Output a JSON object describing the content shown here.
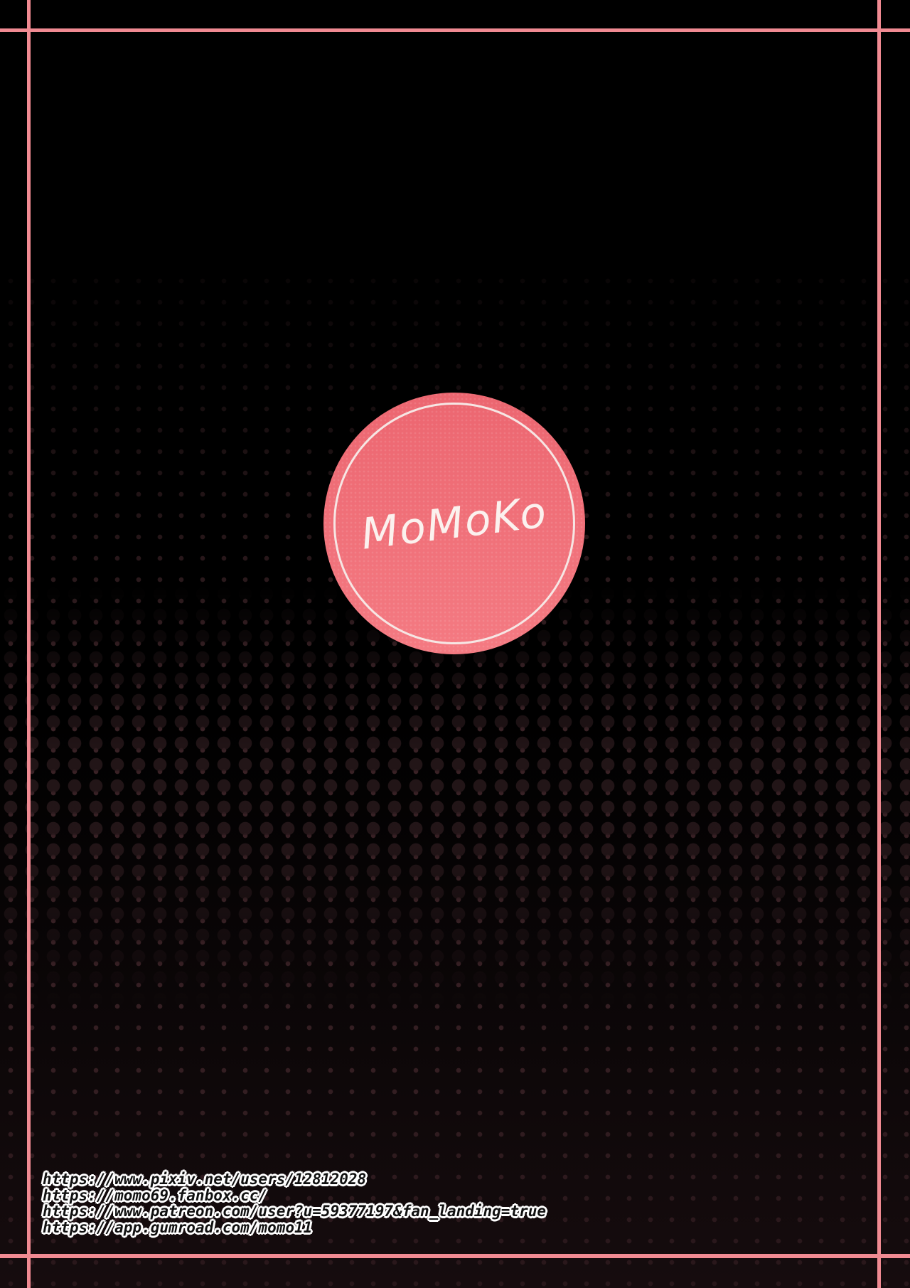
{
  "logo": {
    "text": "MoMoKo"
  },
  "links": [
    "https://www.pixiv.net/users/12812028",
    "https://momo69.fanbox.cc/",
    "https://www.patreon.com/user?u=59377197&fan_landing=true",
    "https://app.gumroad.com/momo11"
  ],
  "colors": {
    "frame": "#f08a92",
    "logo_fill": "#f47a82",
    "background": "#000000"
  }
}
